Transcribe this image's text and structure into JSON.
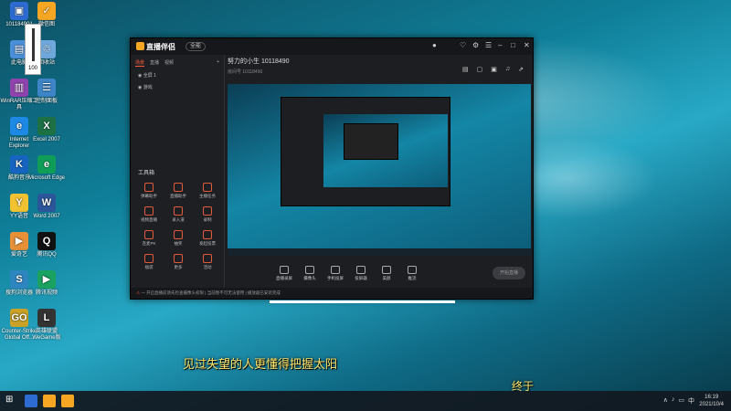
{
  "desktop": {
    "icons": [
      {
        "label": "101184901",
        "symbol": "▣",
        "bg": "#2d6bd3"
      },
      {
        "label": "微信图",
        "symbol": "✓",
        "bg": "#f5a623"
      },
      {
        "label": "此电脑",
        "symbol": "▤",
        "bg": "#4a90d9"
      },
      {
        "label": "回收站",
        "symbol": "♲",
        "bg": "#6fa8dc"
      },
      {
        "label": "WinRAR压缩工具",
        "symbol": "▥",
        "bg": "#8e44ad"
      },
      {
        "label": "控制面板",
        "symbol": "☰",
        "bg": "#3d85c6"
      },
      {
        "label": "Internet Explorer",
        "symbol": "e",
        "bg": "#1e88e5"
      },
      {
        "label": "Excel 2007",
        "symbol": "X",
        "bg": "#1d7044"
      },
      {
        "label": "酷狗音乐",
        "symbol": "K",
        "bg": "#1565c0"
      },
      {
        "label": "Microsoft Edge",
        "symbol": "e",
        "bg": "#0f9d58"
      },
      {
        "label": "YY语音",
        "symbol": "Y",
        "bg": "#f1c232"
      },
      {
        "label": "Word 2007",
        "symbol": "W",
        "bg": "#2b579a"
      },
      {
        "label": "爱奇艺",
        "symbol": "▶",
        "bg": "#e69138"
      },
      {
        "label": "腾讯QQ",
        "symbol": "Q",
        "bg": "#111111"
      },
      {
        "label": "搜狗浏览器",
        "symbol": "S",
        "bg": "#2e86c1"
      },
      {
        "label": "腾讯视频",
        "symbol": "▶",
        "bg": "#1aa260"
      },
      {
        "label": "Counter-Strike Global Off...",
        "symbol": "GO",
        "bg": "#c9a227"
      },
      {
        "label": "英雄联盟 WeGame版",
        "symbol": "L",
        "bg": "#333333"
      }
    ],
    "volume_value": "100"
  },
  "app": {
    "logo": "直播伴侣",
    "mode": "全能",
    "scene_tabs": [
      "场景",
      "直播",
      "视频"
    ],
    "scenes": [
      "全屏 1",
      "游戏"
    ],
    "tools_title": "工具箱",
    "tools": [
      "弹幕助手",
      "直播助手",
      "主播任务",
      "视频直播",
      "录入道",
      "录制",
      "连麦PK",
      "抽奖",
      "发起投票",
      "福袋",
      "更多",
      "活动"
    ],
    "stream_title": "努力的小生 10118490",
    "stream_sub": "房间号 10118490",
    "actions": [
      "直播录屏",
      "摄像头",
      "手机投屏",
      "投屏器",
      "美颜",
      "推流"
    ],
    "start_label": "开始直播",
    "status_text": "一 开启直播前请先检查摄像头权限  |  当前暂不可无法使用  |  播放器已安装完成",
    "status_warn": "⚠"
  },
  "subtitles": {
    "main": "见过失望的人更懂得把握太阳",
    "tail": "终于"
  },
  "taskbar": {
    "clock_time": "16:19",
    "clock_date": "2021/10/4",
    "tray_icons": [
      "∧",
      "♪",
      "▭",
      "中"
    ]
  },
  "colors": {
    "accent": "#ff5a3c",
    "subtitle": "#ffe66a",
    "app_bg": "#1d1e22"
  }
}
